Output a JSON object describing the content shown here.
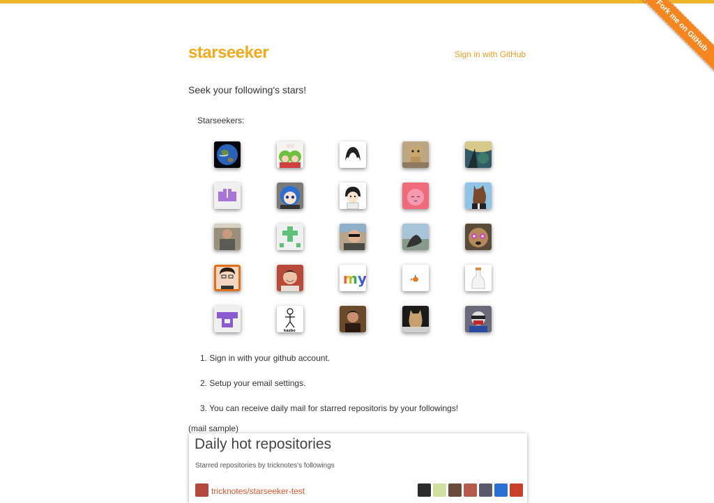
{
  "header": {
    "logo": "starseeker",
    "signin_label": "Sign in with GitHub",
    "ribbon_label": "Fork me on GitHub"
  },
  "main": {
    "tagline": "Seek your following's stars!",
    "seekers_label": "Starseekers:",
    "steps": [
      "1. Sign in with your github account.",
      "2. Setup your email settings.",
      "3. You can receive daily mail for starred repositoris by your followings!"
    ],
    "mail_sample_label": "(mail sample)"
  },
  "mail": {
    "title": "Daily hot repositories",
    "subtitle": "Starred repositories by tricknotes's followings",
    "repo_link": "tricknotes/starseeker-test"
  },
  "colors": {
    "accent": "#f0ac1e",
    "top_bar": "#f0b429",
    "ribbon": "#f5851f",
    "link": "#d9552b"
  },
  "avatars": [
    {
      "name": "earth-avatar"
    },
    {
      "name": "anime-girls-avatar"
    },
    {
      "name": "hair-sketch-avatar"
    },
    {
      "name": "danbo-avatar"
    },
    {
      "name": "tree-avatar"
    },
    {
      "name": "purple-identicon-avatar"
    },
    {
      "name": "blue-hair-avatar"
    },
    {
      "name": "cartoon-boy-avatar"
    },
    {
      "name": "pink-character-avatar"
    },
    {
      "name": "horse-mask-avatar"
    },
    {
      "name": "man-photo-avatar"
    },
    {
      "name": "green-identicon-avatar"
    },
    {
      "name": "sunglasses-avatar"
    },
    {
      "name": "outdoor-avatar"
    },
    {
      "name": "dog-avatar"
    },
    {
      "name": "glasses-man-avatar"
    },
    {
      "name": "smiling-man-avatar"
    },
    {
      "name": "my-logo-avatar"
    },
    {
      "name": "small-fish-avatar"
    },
    {
      "name": "bottle-avatar"
    },
    {
      "name": "purple-tshirt-avatar"
    },
    {
      "name": "stick-figure-avatar"
    },
    {
      "name": "dark-photo-avatar"
    },
    {
      "name": "horse-head-avatar"
    },
    {
      "name": "masked-avatar"
    }
  ],
  "avatar_text": {
    "my_logo": "my",
    "stick_figure": "kazbo"
  }
}
